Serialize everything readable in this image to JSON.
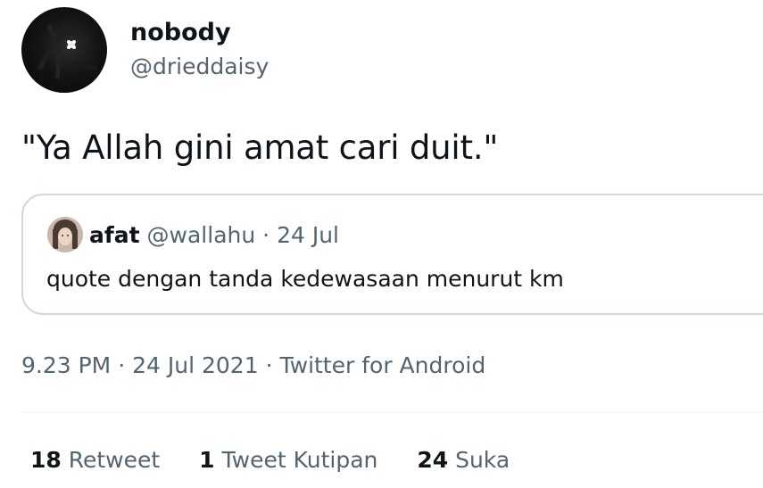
{
  "author": {
    "display_name": "nobody",
    "handle": "@drieddaisy"
  },
  "tweet": {
    "text": "\"Ya Allah gini amat cari duit.\""
  },
  "quoted_tweet": {
    "display_name": "afat",
    "handle": "@wallahu",
    "separator": "·",
    "date": "24 Jul",
    "text": "quote dengan tanda kedewasaan menurut km"
  },
  "meta": {
    "time": "9.23 PM",
    "sep1": "·",
    "date": "24 Jul 2021",
    "sep2": "·",
    "source": "Twitter for Android"
  },
  "stats": [
    {
      "count": "18",
      "label": "Retweet"
    },
    {
      "count": "1",
      "label": "Tweet Kutipan"
    },
    {
      "count": "24",
      "label": "Suka"
    }
  ],
  "colors": {
    "text_primary": "#0f1419",
    "text_secondary": "#536471",
    "border": "#cfd9de",
    "divider": "#eff3f4"
  }
}
